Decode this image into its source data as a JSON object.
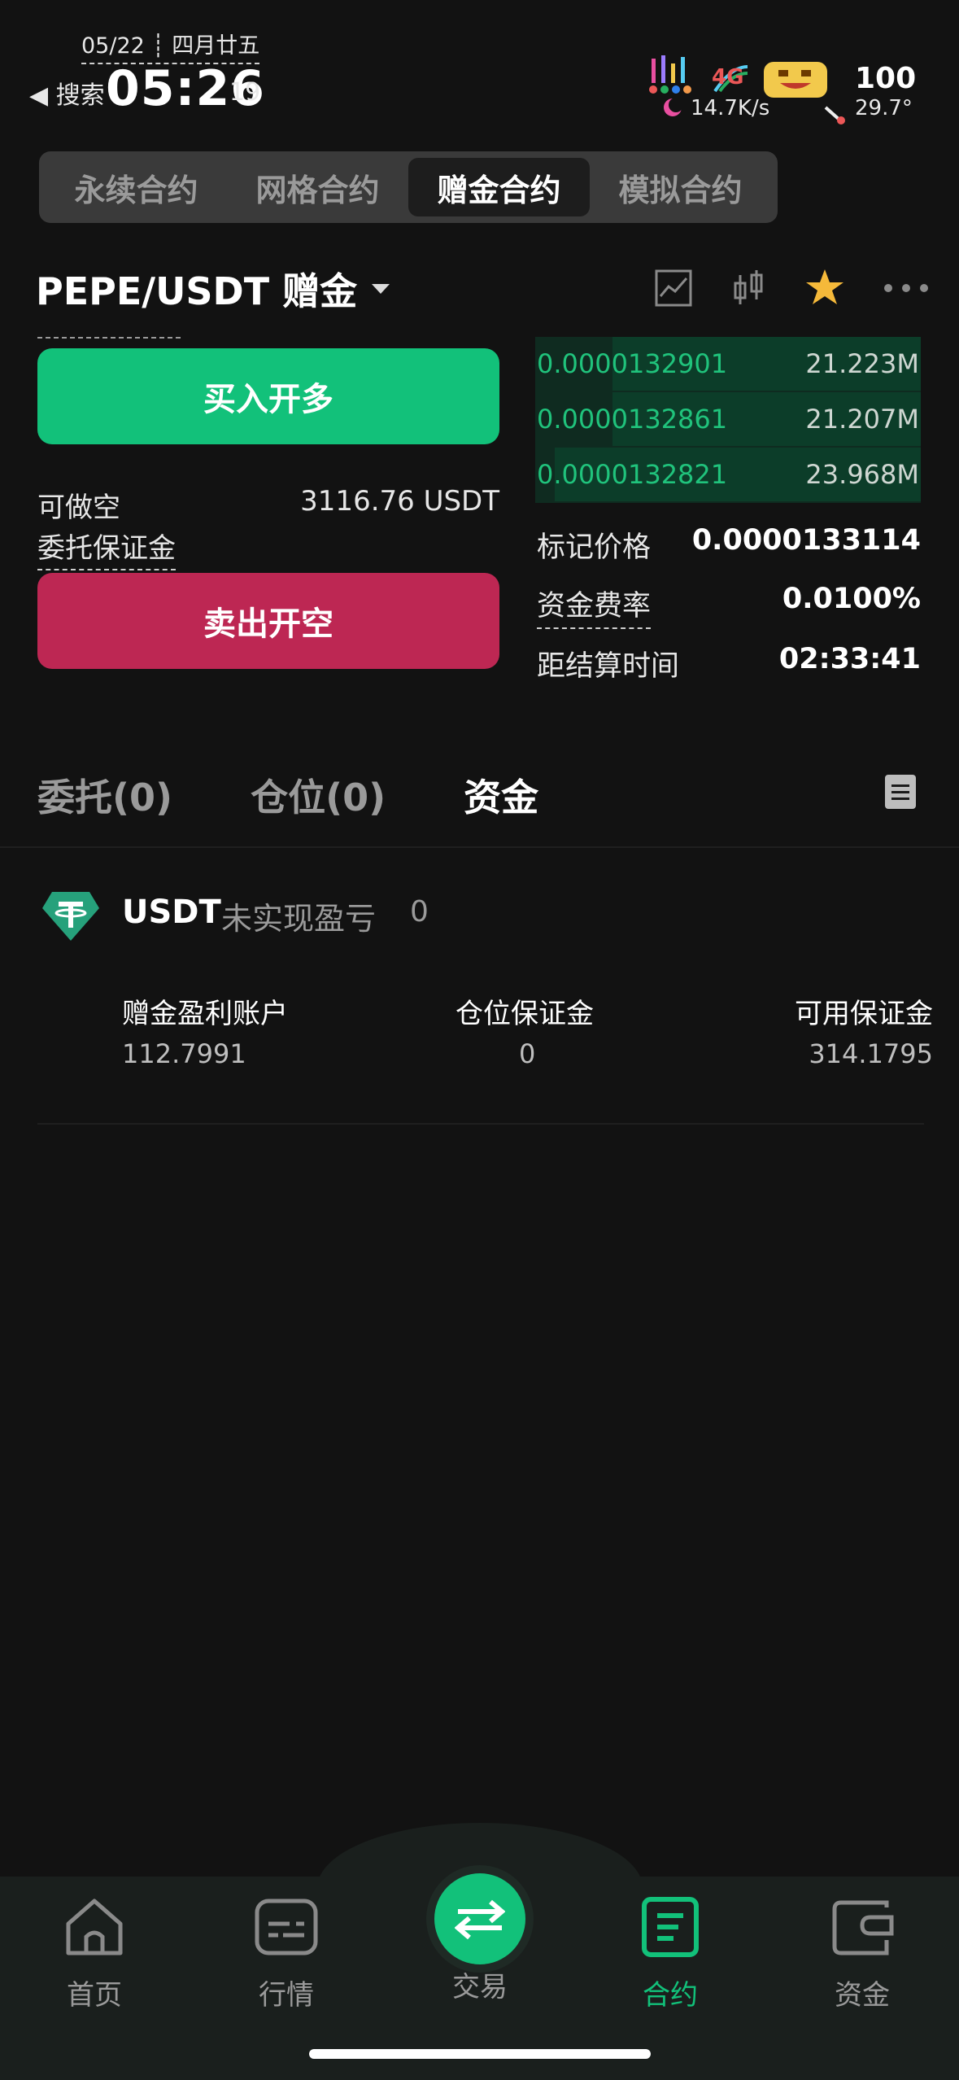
{
  "status_bar": {
    "date": "05/22 ┊ 四月廿五",
    "back_label": "◀ 搜索",
    "time": "05:26",
    "seconds": "19",
    "net_speed": "14.7K/s",
    "network": "4G",
    "battery": "100",
    "temperature": "29.7°"
  },
  "top_tabs": [
    {
      "label": "永续合约",
      "active": false
    },
    {
      "label": "网格合约",
      "active": false
    },
    {
      "label": "赠金合约",
      "active": true
    },
    {
      "label": "模拟合约",
      "active": false
    }
  ],
  "pair": {
    "symbol": "PEPE/USDT 赠金",
    "icons": [
      "chart-line-icon",
      "candlestick-icon",
      "star-icon",
      "more-icon"
    ]
  },
  "actions": {
    "long_label": "买入开多",
    "short_label": "卖出开空",
    "available_label": "可做空",
    "available_value": "3116.76 USDT",
    "margin_label": "委托保证金"
  },
  "order_book": [
    {
      "price": "0.0000132901",
      "volume": "21.223M",
      "depth": 0.8
    },
    {
      "price": "0.0000132861",
      "volume": "21.207M",
      "depth": 0.8
    },
    {
      "price": "0.0000132821",
      "volume": "23.968M",
      "depth": 0.95
    }
  ],
  "market_info": [
    {
      "label": "标记价格",
      "value": "0.0000133114",
      "dashed": false
    },
    {
      "label": "资金费率",
      "value": "0.0100%",
      "dashed": true
    },
    {
      "label": "距结算时间",
      "value": "02:33:41",
      "dashed": false
    }
  ],
  "section_tabs": [
    {
      "label": "委托(0)",
      "active": false
    },
    {
      "label": "仓位(0)",
      "active": false
    },
    {
      "label": "资金",
      "active": true
    }
  ],
  "asset": {
    "name": "USDT",
    "unrealized_label": "未实现盈亏",
    "unrealized_value": "0",
    "columns": [
      {
        "label": "赠金盈利账户",
        "value": "112.7991"
      },
      {
        "label": "仓位保证金",
        "value": "0"
      },
      {
        "label": "可用保证金",
        "value": "314.1795"
      }
    ]
  },
  "bottom_nav": [
    {
      "label": "首页",
      "icon": "home-icon",
      "active": false
    },
    {
      "label": "行情",
      "icon": "market-icon",
      "active": false
    },
    {
      "label": "交易",
      "icon": "swap-icon",
      "active": false
    },
    {
      "label": "合约",
      "icon": "contract-icon",
      "active": true
    },
    {
      "label": "资金",
      "icon": "wallet-icon",
      "active": false
    }
  ],
  "colors": {
    "accent_green": "#12c17a",
    "accent_red": "#bd2753",
    "star": "#f5b93a"
  }
}
